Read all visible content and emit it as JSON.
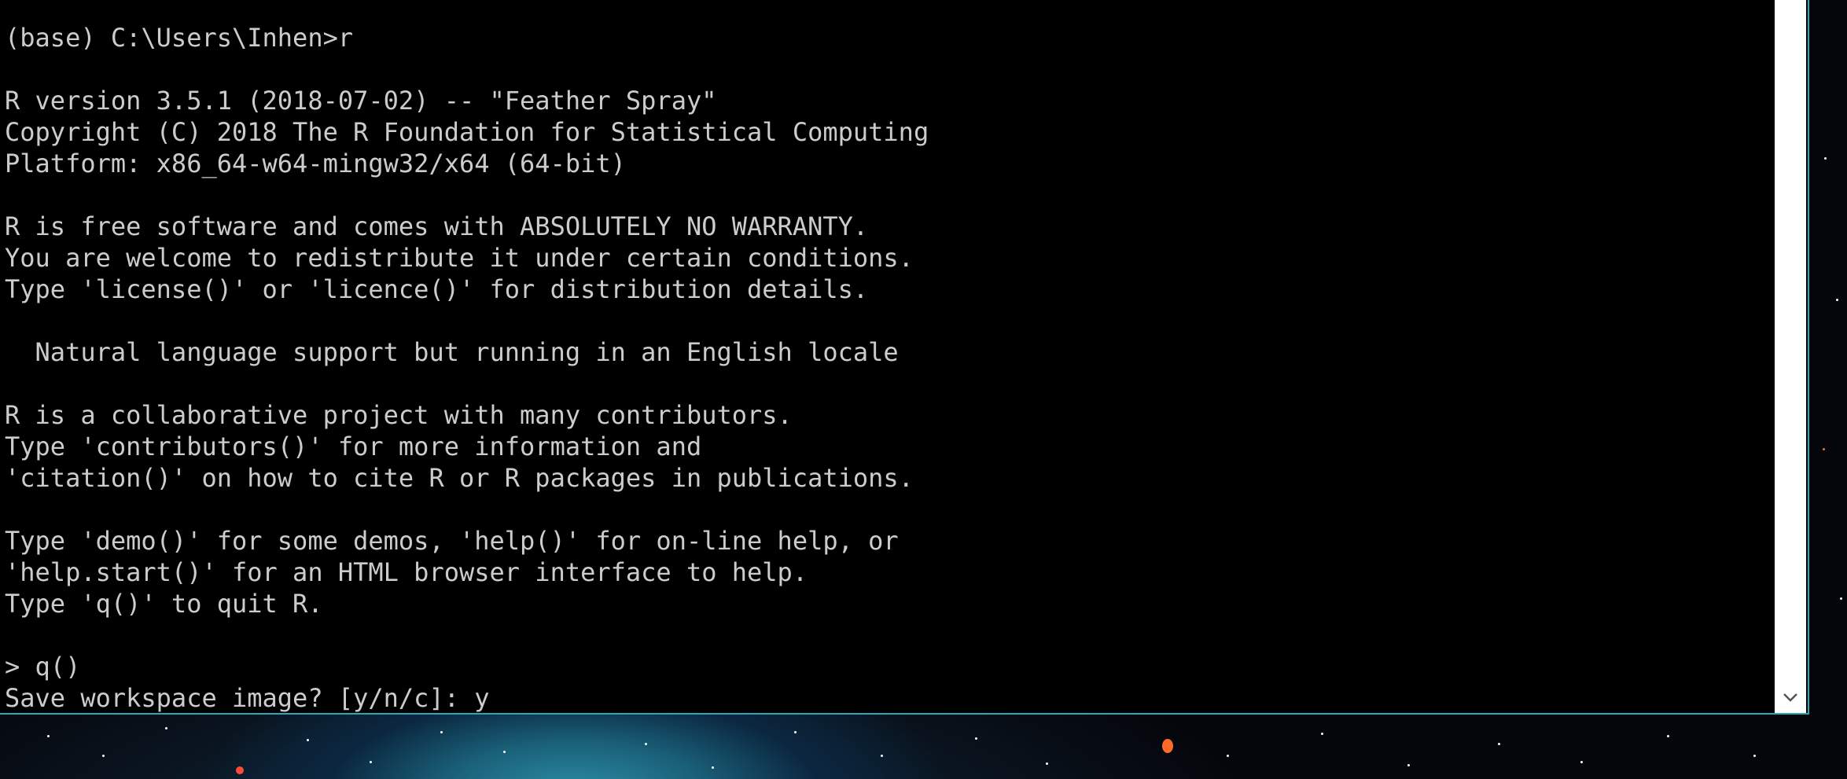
{
  "console": {
    "lines": [
      "(base) C:\\Users\\Inhen>r",
      "",
      "R version 3.5.1 (2018-07-02) -- \"Feather Spray\"",
      "Copyright (C) 2018 The R Foundation for Statistical Computing",
      "Platform: x86_64-w64-mingw32/x64 (64-bit)",
      "",
      "R is free software and comes with ABSOLUTELY NO WARRANTY.",
      "You are welcome to redistribute it under certain conditions.",
      "Type 'license()' or 'licence()' for distribution details.",
      "",
      "  Natural language support but running in an English locale",
      "",
      "R is a collaborative project with many contributors.",
      "Type 'contributors()' for more information and",
      "'citation()' on how to cite R or R packages in publications.",
      "",
      "Type 'demo()' for some demos, 'help()' for on-line help, or",
      "'help.start()' for an HTML browser interface to help.",
      "Type 'q()' to quit R.",
      "",
      "> q()",
      "Save workspace image? [y/n/c]: y"
    ]
  },
  "scrollbar": {
    "down_icon": "chevron-down-icon"
  },
  "colors": {
    "console_background": "#000000",
    "console_text": "#cccccc",
    "window_border": "#2aa7b8"
  }
}
